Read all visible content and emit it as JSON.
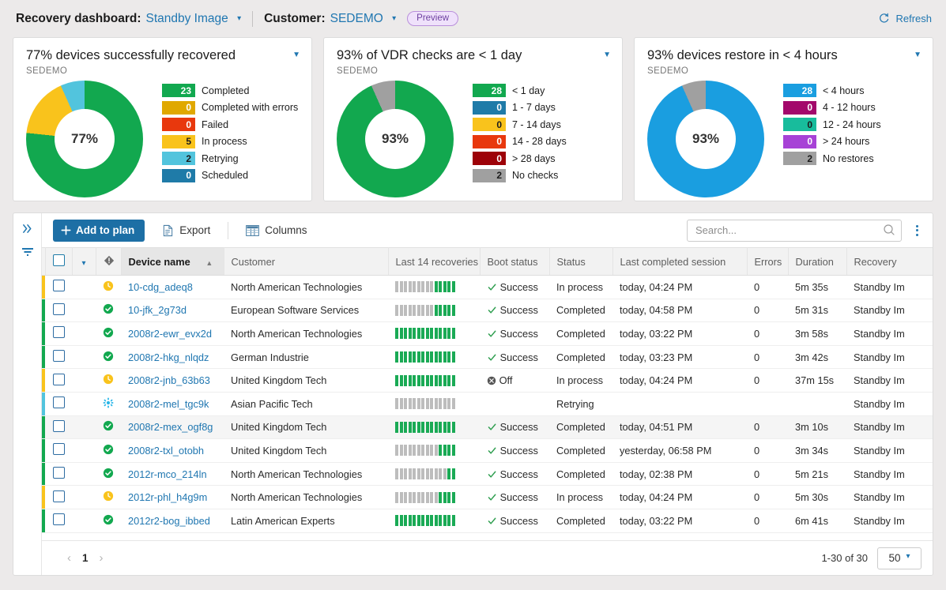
{
  "header": {
    "dashboard_label": "Recovery dashboard:",
    "dashboard_value": "Standby Image",
    "customer_label": "Customer:",
    "customer_value": "SEDEMO",
    "preview_badge": "Preview",
    "refresh_label": "Refresh"
  },
  "cards": [
    {
      "title": "77% devices successfully recovered",
      "subtitle": "SEDEMO",
      "center": "77%",
      "legend": [
        {
          "value": "23",
          "label": "Completed",
          "color": "#12a84f",
          "dark": false
        },
        {
          "value": "0",
          "label": "Completed with errors",
          "color": "#e0a800",
          "dark": false
        },
        {
          "value": "0",
          "label": "Failed",
          "color": "#e8380d",
          "dark": false
        },
        {
          "value": "5",
          "label": "In process",
          "color": "#f9c31c",
          "dark": true
        },
        {
          "value": "2",
          "label": "Retrying",
          "color": "#52c4dd",
          "dark": true
        },
        {
          "value": "0",
          "label": "Scheduled",
          "color": "#1f7ba8",
          "dark": false
        }
      ]
    },
    {
      "title": "93% of VDR checks are < 1 day",
      "subtitle": "SEDEMO",
      "center": "93%",
      "legend": [
        {
          "value": "28",
          "label": "< 1 day",
          "color": "#12a84f",
          "dark": false
        },
        {
          "value": "0",
          "label": "1 - 7 days",
          "color": "#1f7ba8",
          "dark": false
        },
        {
          "value": "0",
          "label": "7 - 14 days",
          "color": "#f9c31c",
          "dark": true
        },
        {
          "value": "0",
          "label": "14 - 28 days",
          "color": "#e8380d",
          "dark": false
        },
        {
          "value": "0",
          "label": "> 28 days",
          "color": "#9d0208",
          "dark": false
        },
        {
          "value": "2",
          "label": "No checks",
          "color": "#a0a0a0",
          "dark": true
        }
      ]
    },
    {
      "title": "93% devices restore in < 4 hours",
      "subtitle": "SEDEMO",
      "center": "93%",
      "legend": [
        {
          "value": "28",
          "label": "< 4 hours",
          "color": "#1a9ee0",
          "dark": false
        },
        {
          "value": "0",
          "label": "4 - 12 hours",
          "color": "#a3086b",
          "dark": false
        },
        {
          "value": "0",
          "label": "12 - 24 hours",
          "color": "#18bc9c",
          "dark": true
        },
        {
          "value": "0",
          "label": "> 24 hours",
          "color": "#a742d6",
          "dark": false
        },
        {
          "value": "2",
          "label": "No restores",
          "color": "#a0a0a0",
          "dark": true
        }
      ]
    }
  ],
  "chart_data": [
    {
      "type": "pie",
      "title": "77% devices successfully recovered",
      "subtitle": "SEDEMO",
      "center_label": "77%",
      "legend_position": "right",
      "categories": [
        "Completed",
        "Completed with errors",
        "Failed",
        "In process",
        "Retrying",
        "Scheduled"
      ],
      "values": [
        23,
        0,
        0,
        5,
        2,
        0
      ],
      "colors": [
        "#12a84f",
        "#e0a800",
        "#e8380d",
        "#f9c31c",
        "#52c4dd",
        "#1f7ba8"
      ]
    },
    {
      "type": "pie",
      "title": "93% of VDR checks are < 1 day",
      "subtitle": "SEDEMO",
      "center_label": "93%",
      "legend_position": "right",
      "categories": [
        "< 1 day",
        "1 - 7 days",
        "7 - 14 days",
        "14 - 28 days",
        "> 28 days",
        "No checks"
      ],
      "values": [
        28,
        0,
        0,
        0,
        0,
        2
      ],
      "colors": [
        "#12a84f",
        "#1f7ba8",
        "#f9c31c",
        "#e8380d",
        "#9d0208",
        "#a0a0a0"
      ]
    },
    {
      "type": "pie",
      "title": "93% devices restore in < 4 hours",
      "subtitle": "SEDEMO",
      "center_label": "93%",
      "legend_position": "right",
      "categories": [
        "< 4 hours",
        "4 - 12 hours",
        "12 - 24 hours",
        "> 24 hours",
        "No restores"
      ],
      "values": [
        28,
        0,
        0,
        0,
        2
      ],
      "colors": [
        "#1a9ee0",
        "#a3086b",
        "#18bc9c",
        "#a742d6",
        "#a0a0a0"
      ]
    }
  ],
  "toolbar": {
    "add_to_plan": "Add to plan",
    "export": "Export",
    "columns": "Columns",
    "search_placeholder": "Search...",
    "search_value": ""
  },
  "table": {
    "columns": [
      "Device name",
      "Customer",
      "Last 14 recoveries",
      "Boot status",
      "Status",
      "Last completed session",
      "Errors",
      "Duration",
      "Recovery"
    ],
    "sort_column": "Device name",
    "sort_direction": "asc",
    "rows": [
      {
        "strip": "#f9c31c",
        "state": "inprocess",
        "device": "10-cdg_adeq8",
        "customer": "North American Technologies",
        "spark": "gggggggggGGGGG",
        "boot": "Success",
        "status": "In process",
        "session": "today, 04:24 PM",
        "errors": "0",
        "duration": "5m 35s",
        "recovery": "Standby Im"
      },
      {
        "strip": "#12a84f",
        "state": "ok",
        "device": "10-jfk_2g73d",
        "customer": "European Software Services",
        "spark": "gggggggggGGGGG",
        "boot": "Success",
        "status": "Completed",
        "session": "today, 04:58 PM",
        "errors": "0",
        "duration": "5m 31s",
        "recovery": "Standby Im"
      },
      {
        "strip": "#12a84f",
        "state": "ok",
        "device": "2008r2-ewr_evx2d",
        "customer": "North American Technologies",
        "spark": "GGGGGGGGGGGGGG",
        "boot": "Success",
        "status": "Completed",
        "session": "today, 03:22 PM",
        "errors": "0",
        "duration": "3m 58s",
        "recovery": "Standby Im"
      },
      {
        "strip": "#12a84f",
        "state": "ok",
        "device": "2008r2-hkg_nlqdz",
        "customer": "German Industrie",
        "spark": "GGGGGGGGGGGGGG",
        "boot": "Success",
        "status": "Completed",
        "session": "today, 03:23 PM",
        "errors": "0",
        "duration": "3m 42s",
        "recovery": "Standby Im"
      },
      {
        "strip": "#f9c31c",
        "state": "inprocess",
        "device": "2008r2-jnb_63b63",
        "customer": "United Kingdom Tech",
        "spark": "GGGGGGGGGGGGGG",
        "boot": "Off",
        "status": "In process",
        "session": "today, 04:24 PM",
        "errors": "0",
        "duration": "37m 15s",
        "recovery": "Standby Im"
      },
      {
        "strip": "#52c4dd",
        "state": "retrying",
        "device": "2008r2-mel_tgc9k",
        "customer": "Asian Pacific Tech",
        "spark": "gggggggggggggg",
        "boot": "",
        "status": "Retrying",
        "session": "",
        "errors": "",
        "duration": "",
        "recovery": "Standby Im"
      },
      {
        "strip": "#12a84f",
        "state": "ok",
        "device": "2008r2-mex_ogf8g",
        "customer": "United Kingdom Tech",
        "spark": "GGGGGGGGGGGGGG",
        "boot": "Success",
        "status": "Completed",
        "session": "today, 04:51 PM",
        "errors": "0",
        "duration": "3m 10s",
        "recovery": "Standby Im"
      },
      {
        "strip": "#12a84f",
        "state": "ok",
        "device": "2008r2-txl_otobh",
        "customer": "United Kingdom Tech",
        "spark": "ggggggggggGGGG",
        "boot": "Success",
        "status": "Completed",
        "session": "yesterday, 06:58 PM",
        "errors": "0",
        "duration": "3m 34s",
        "recovery": "Standby Im"
      },
      {
        "strip": "#12a84f",
        "state": "ok",
        "device": "2012r-mco_214ln",
        "customer": "North American Technologies",
        "spark": "ggggggggggggGG",
        "boot": "Success",
        "status": "Completed",
        "session": "today, 02:38 PM",
        "errors": "0",
        "duration": "5m 21s",
        "recovery": "Standby Im"
      },
      {
        "strip": "#f9c31c",
        "state": "inprocess",
        "device": "2012r-phl_h4g9m",
        "customer": "North American Technologies",
        "spark": "ggggggggggGGGG",
        "boot": "Success",
        "status": "In process",
        "session": "today, 04:24 PM",
        "errors": "0",
        "duration": "5m 30s",
        "recovery": "Standby Im"
      },
      {
        "strip": "#12a84f",
        "state": "ok",
        "device": "2012r2-bog_ibbed",
        "customer": "Latin American Experts",
        "spark": "GGGGGGGGGGGGGG",
        "boot": "Success",
        "status": "Completed",
        "session": "today, 03:22 PM",
        "errors": "0",
        "duration": "6m 41s",
        "recovery": "Standby Im"
      }
    ]
  },
  "footer": {
    "page_number": "1",
    "range": "1-30 of 30",
    "page_size": "50"
  }
}
